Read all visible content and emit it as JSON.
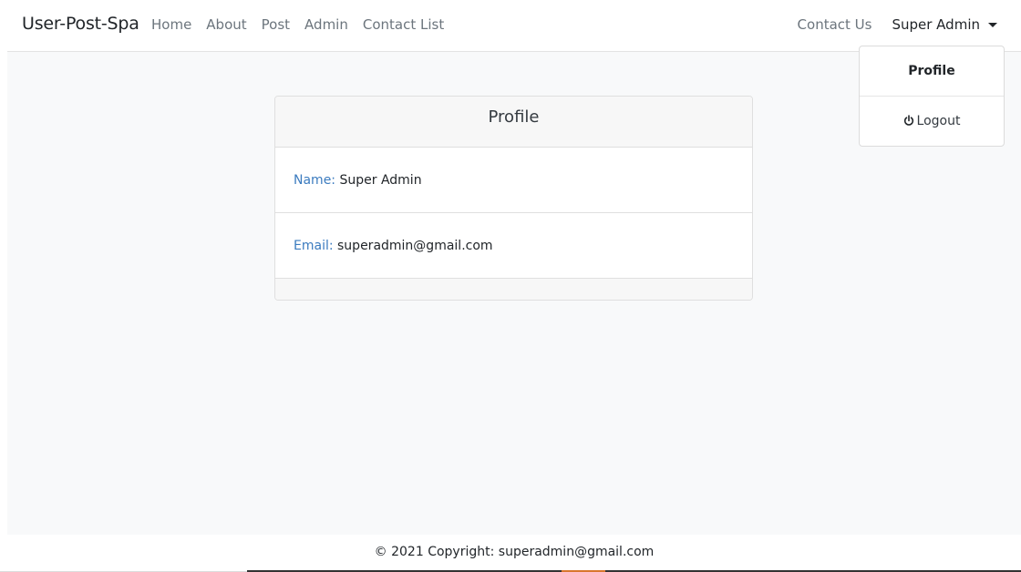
{
  "navbar": {
    "brand": "User-Post-Spa",
    "links": [
      "Home",
      "About",
      "Post",
      "Admin",
      "Contact List"
    ],
    "contact": "Contact Us",
    "user": "Super Admin"
  },
  "dropdown": {
    "items": [
      "Profile",
      "Logout"
    ]
  },
  "profile": {
    "title": "Profile",
    "name_label": "Name:",
    "name_value": "Super Admin",
    "email_label": "Email:",
    "email_value": "superadmin@gmail.com"
  },
  "footer": {
    "text": "© 2021 Copyright: superadmin@gmail.com"
  },
  "colors": {
    "label": "#3b7bbf",
    "background": "#f8f9fa",
    "accent": "#d9772f"
  },
  "icons": {
    "logout": "power-icon",
    "user_menu": "caret-down-icon"
  }
}
